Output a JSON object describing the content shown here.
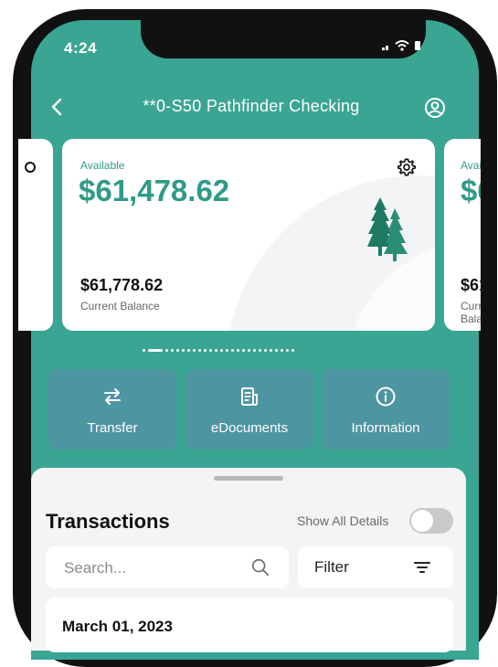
{
  "status_bar": {
    "time": "4:24"
  },
  "header": {
    "title": "**0-S50 Pathfinder Checking"
  },
  "account_card": {
    "available_label": "Available",
    "available_amount": "$61,478.62",
    "current_balance_amount": "$61,778.62",
    "current_balance_label": "Current Balance"
  },
  "pager": {
    "total": 26,
    "active_index": 1
  },
  "actions": [
    {
      "label": "Transfer",
      "icon": "transfer-arrows-icon"
    },
    {
      "label": "eDocuments",
      "icon": "document-icon"
    },
    {
      "label": "Information",
      "icon": "info-icon"
    }
  ],
  "transactions": {
    "title": "Transactions",
    "show_all_details_label": "Show All Details",
    "show_all_details_on": false,
    "search_placeholder": "Search...",
    "filter_label": "Filter",
    "first_row_date": "March 01, 2023"
  },
  "colors": {
    "brand_teal": "#3aa593",
    "tile_blue": "#4e95a2",
    "amount_teal": "#2f9a88"
  }
}
